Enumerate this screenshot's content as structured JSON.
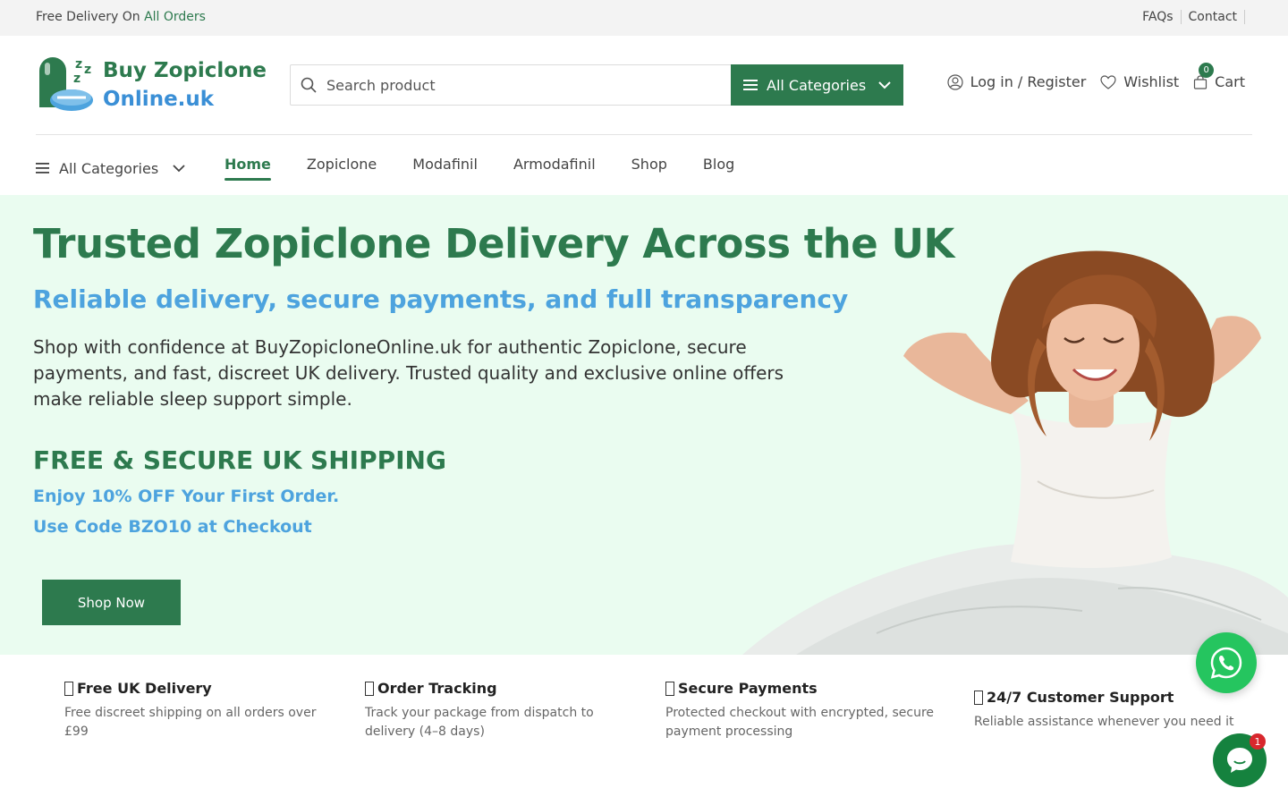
{
  "topbar": {
    "promo_prefix": "Free Delivery On",
    "promo_accent": "All Orders",
    "links": [
      "FAQs",
      "Contact"
    ]
  },
  "logo": {
    "line1": "Buy Zopiclone",
    "line2": "Online.uk"
  },
  "search": {
    "placeholder": "Search product",
    "category_label": "All Categories"
  },
  "header_actions": {
    "login_label": "Log in / Register",
    "wishlist_label": "Wishlist",
    "cart_label": "Cart",
    "cart_count": "0"
  },
  "nav": {
    "all_categories": "All Categories",
    "links": [
      "Home",
      "Zopiclone",
      "Modafinil",
      "Armodafinil",
      "Shop",
      "Blog"
    ],
    "active": "Home"
  },
  "hero": {
    "title": "Trusted Zopiclone Delivery Across the UK",
    "subtitle": "Reliable delivery, secure payments, and full transparency",
    "description": "Shop with confidence at BuyZopicloneOnline.uk for authentic Zopiclone, secure payments, and fast, discreet UK delivery. Trusted quality and exclusive online offers make reliable sleep support simple.",
    "shipping_heading": "FREE & SECURE UK SHIPPING",
    "promo_line1": "Enjoy 10% OFF Your First Order.",
    "promo_line2": "Use Code BZO10 at Checkout",
    "cta": "Shop Now"
  },
  "features": [
    {
      "title": "Free UK Delivery",
      "desc": "Free discreet shipping on all orders over £99"
    },
    {
      "title": "Order Tracking",
      "desc": "Track your package from dispatch to delivery (4–8 days)"
    },
    {
      "title": "Secure Payments",
      "desc": "Protected checkout with encrypted, secure payment processing"
    },
    {
      "title": "24/7 Customer Support",
      "desc": "Reliable assistance whenever you need it"
    }
  ],
  "chat": {
    "unread": "1"
  },
  "colors": {
    "brand_green": "#2d7a4e",
    "brand_blue": "#4da3de",
    "hero_bg": "#eafcf0",
    "whatsapp": "#25c55f"
  }
}
